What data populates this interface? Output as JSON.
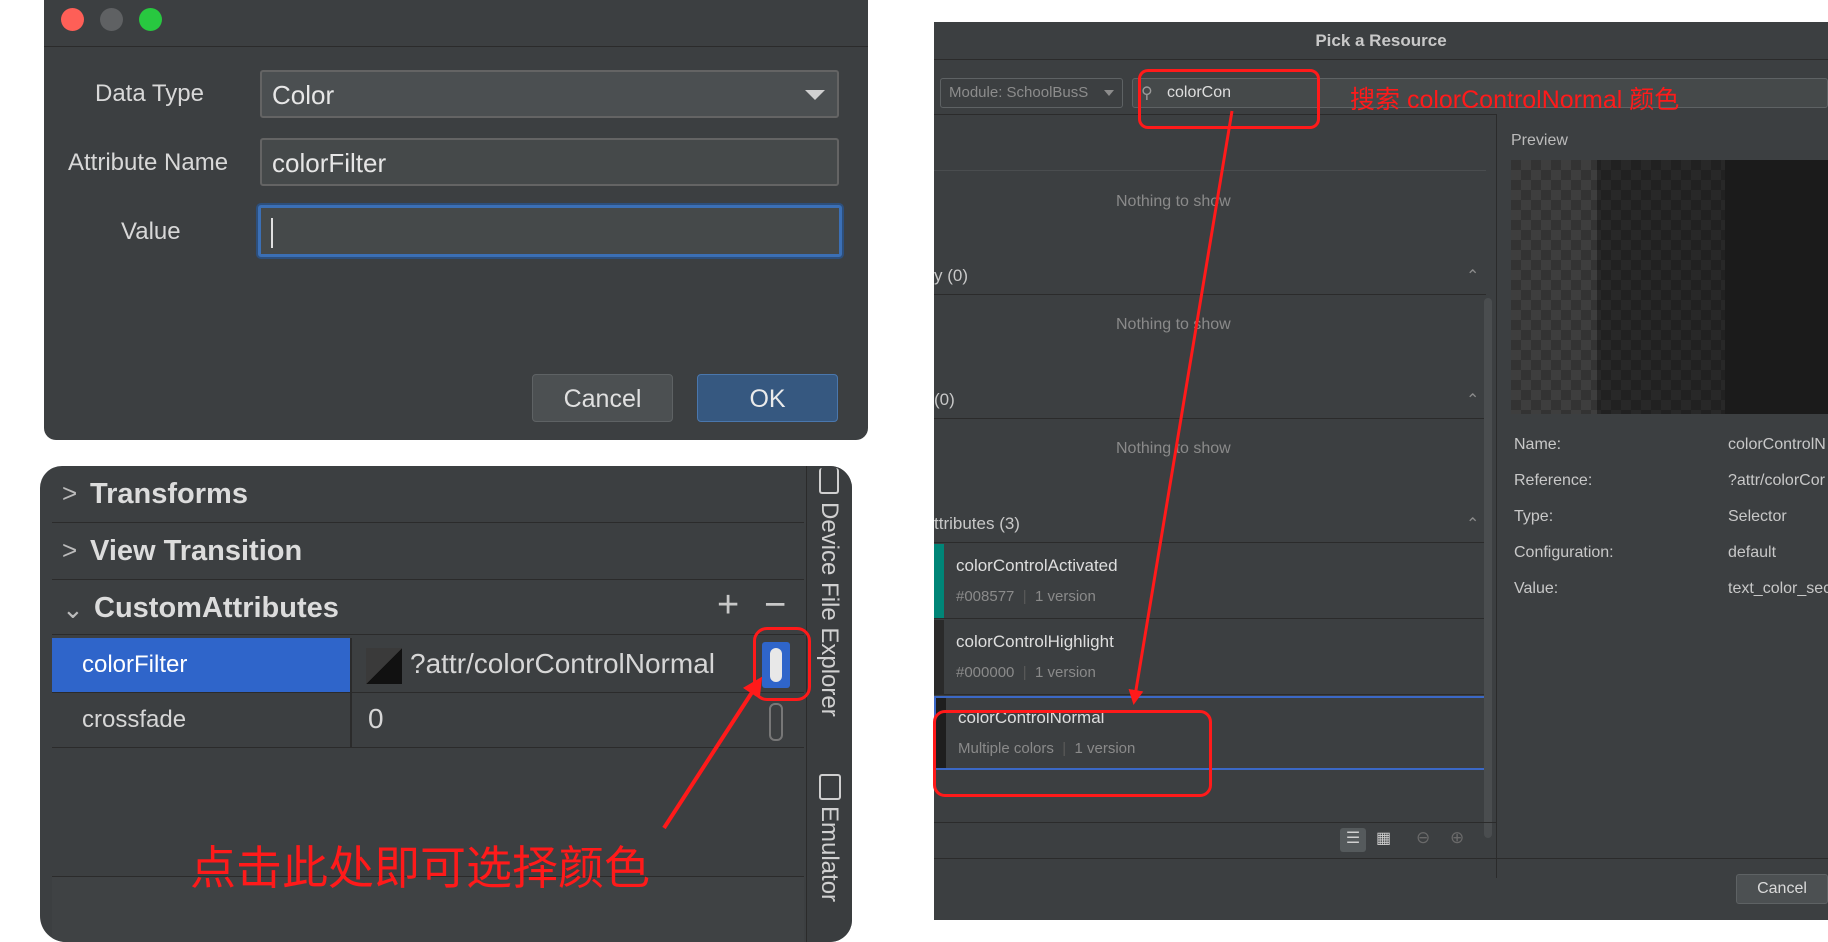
{
  "dialog": {
    "data_type_label": "Data Type",
    "data_type_value": "Color",
    "attribute_name_label": "Attribute Name",
    "attribute_name_value": "colorFilter",
    "value_label": "Value",
    "value_value": "",
    "cancel_label": "Cancel",
    "ok_label": "OK"
  },
  "attributes_panel": {
    "sections": [
      "Transforms",
      "View Transition",
      "CustomAttributes"
    ],
    "add_icon": "+",
    "remove_icon": "−",
    "rows": [
      {
        "name": "colorFilter",
        "value": "?attr/colorControlNormal"
      },
      {
        "name": "crossfade",
        "value": "0"
      }
    ],
    "side_tabs": [
      "Device File Explorer",
      "Emulator"
    ],
    "annotation": "点击此处即可选择颜色"
  },
  "resource_picker": {
    "title": "Pick a Resource",
    "module_select": "Module: SchoolBusS",
    "search_value": "colorCon",
    "search_annotation": "搜索 colorControlNormal 颜色",
    "preview_label": "Preview",
    "nothing_to_show": "Nothing to show",
    "groups": [
      "y (0)",
      "(0)",
      "ttributes (3)"
    ],
    "items": [
      {
        "name": "colorControlActivated",
        "detail": "#008577",
        "versions": "1 version",
        "color": "#008577"
      },
      {
        "name": "colorControlHighlight",
        "detail": "#000000",
        "versions": "1 version",
        "color": "#2a2a2a"
      },
      {
        "name": "colorControlNormal",
        "detail": "Multiple colors",
        "versions": "1 version",
        "color": "#1e1e1e"
      }
    ],
    "properties": [
      {
        "key": "Name:",
        "value": "colorControlN"
      },
      {
        "key": "Reference:",
        "value": "?attr/colorCor"
      },
      {
        "key": "Type:",
        "value": "Selector"
      },
      {
        "key": "Configuration:",
        "value": "default"
      },
      {
        "key": "Value:",
        "value": "text_color_sec"
      }
    ],
    "cancel_label": "Cancel"
  },
  "colors": {
    "accent_blue": "#2f65ca",
    "annotation_red": "#ff1a1a"
  }
}
